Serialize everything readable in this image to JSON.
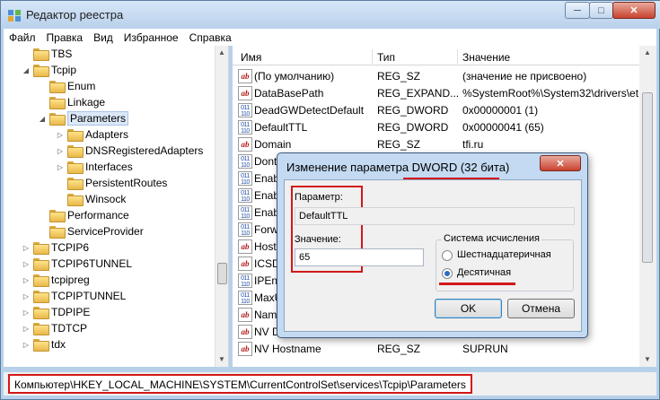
{
  "window": {
    "title": "Редактор реестра",
    "min_glyph": "─",
    "max_glyph": "□",
    "close_glyph": "✕"
  },
  "menu": [
    "Файл",
    "Правка",
    "Вид",
    "Избранное",
    "Справка"
  ],
  "tree": [
    {
      "label": "TBS",
      "level": 1,
      "expander": ""
    },
    {
      "label": "Tcpip",
      "level": 1,
      "expander": "◢"
    },
    {
      "label": "Enum",
      "level": 2,
      "expander": ""
    },
    {
      "label": "Linkage",
      "level": 2,
      "expander": ""
    },
    {
      "label": "Parameters",
      "level": 2,
      "expander": "◢",
      "selected": true
    },
    {
      "label": "Adapters",
      "level": 3,
      "expander": "▷"
    },
    {
      "label": "DNSRegisteredAdapters",
      "level": 3,
      "expander": "▷"
    },
    {
      "label": "Interfaces",
      "level": 3,
      "expander": "▷"
    },
    {
      "label": "PersistentRoutes",
      "level": 3,
      "expander": ""
    },
    {
      "label": "Winsock",
      "level": 3,
      "expander": ""
    },
    {
      "label": "Performance",
      "level": 2,
      "expander": ""
    },
    {
      "label": "ServiceProvider",
      "level": 2,
      "expander": ""
    },
    {
      "label": "TCPIP6",
      "level": 1,
      "expander": "▷"
    },
    {
      "label": "TCPIP6TUNNEL",
      "level": 1,
      "expander": "▷"
    },
    {
      "label": "tcpipreg",
      "level": 1,
      "expander": "▷"
    },
    {
      "label": "TCPIPTUNNEL",
      "level": 1,
      "expander": "▷"
    },
    {
      "label": "TDPIPE",
      "level": 1,
      "expander": "▷"
    },
    {
      "label": "TDTCP",
      "level": 1,
      "expander": "▷"
    },
    {
      "label": "tdx",
      "level": 1,
      "expander": "▷"
    }
  ],
  "columns": {
    "name": "Имя",
    "type": "Тип",
    "value": "Значение"
  },
  "values": [
    {
      "icon": "sz",
      "name": "(По умолчанию)",
      "type": "REG_SZ",
      "value": "(значение не присвоено)"
    },
    {
      "icon": "sz",
      "name": "DataBasePath",
      "type": "REG_EXPAND...",
      "value": "%SystemRoot%\\System32\\drivers\\et"
    },
    {
      "icon": "dw",
      "name": "DeadGWDetectDefault",
      "type": "REG_DWORD",
      "value": "0x00000001 (1)"
    },
    {
      "icon": "dw",
      "name": "DefaultTTL",
      "type": "REG_DWORD",
      "value": "0x00000041 (65)"
    },
    {
      "icon": "sz",
      "name": "Domain",
      "type": "REG_SZ",
      "value": "tfi.ru"
    },
    {
      "icon": "dw",
      "name": "Dont",
      "type": "",
      "value": ""
    },
    {
      "icon": "dw",
      "name": "Enab",
      "type": "",
      "value": ""
    },
    {
      "icon": "dw",
      "name": "Enab",
      "type": "",
      "value": ""
    },
    {
      "icon": "dw",
      "name": "Enab",
      "type": "",
      "value": ""
    },
    {
      "icon": "dw",
      "name": "Forw",
      "type": "",
      "value": ""
    },
    {
      "icon": "sz",
      "name": "Host",
      "type": "",
      "value": ""
    },
    {
      "icon": "sz",
      "name": "ICSD",
      "type": "",
      "value": ""
    },
    {
      "icon": "dw",
      "name": "IPEna",
      "type": "",
      "value": ""
    },
    {
      "icon": "dw",
      "name": "MaxU",
      "type": "",
      "value": ""
    },
    {
      "icon": "sz",
      "name": "Nam",
      "type": "",
      "value": ""
    },
    {
      "icon": "sz",
      "name": "NV D",
      "type": "",
      "value": ""
    },
    {
      "icon": "sz",
      "name": "NV Hostname",
      "type": "REG_SZ",
      "value": "SUPRUN"
    }
  ],
  "statusbar": {
    "path": "Компьютер\\HKEY_LOCAL_MACHINE\\SYSTEM\\CurrentControlSet\\services\\Tcpip\\Parameters"
  },
  "dialog": {
    "title": "Изменение параметра DWORD (32 бита)",
    "close_glyph": "✕",
    "param_label": "Параметр:",
    "param_value": "DefaultTTL",
    "value_label": "Значение:",
    "value_input": "65",
    "base_group_label": "Система исчисления",
    "hex_label": "Шестнадцатеричная",
    "dec_label": "Десятичная",
    "selected_base": "dec",
    "ok_label": "OK",
    "cancel_label": "Отмена"
  },
  "colors": {
    "highlight_red": "#d21818",
    "title_bg": "#b9d1ec",
    "close_red": "#c8432f"
  }
}
